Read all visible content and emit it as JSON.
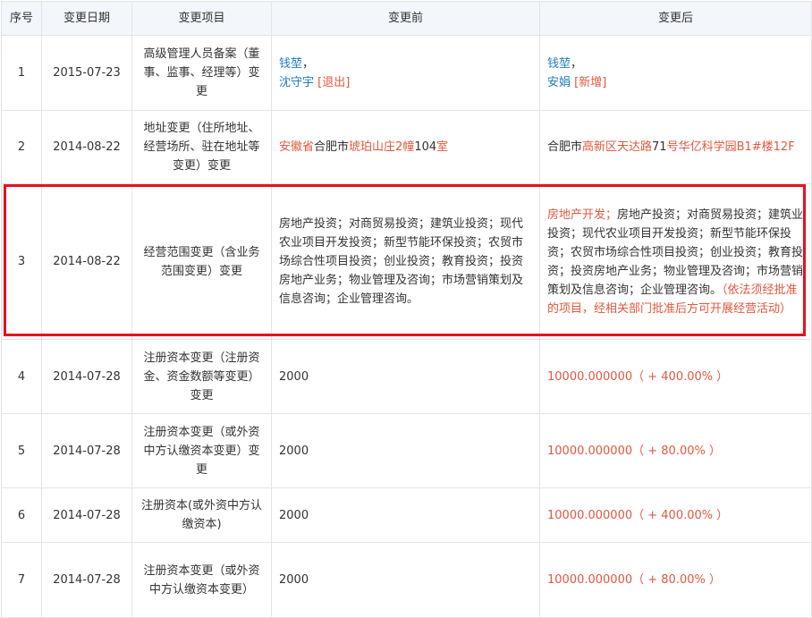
{
  "table": {
    "headers": [
      "序号",
      "变更日期",
      "变更项目",
      "变更前",
      "变更后"
    ],
    "rows": [
      {
        "idx": "1",
        "date": "2015-07-23",
        "item": "高级管理人员备案（董事、监事、经理等）变更",
        "before": {
          "name1": "钱堃",
          "sep1": "，",
          "name2": "沈守宇",
          "tag2": "[退出]"
        },
        "after": {
          "name1": "钱堃",
          "sep1": "，",
          "name2": "安娟",
          "tag2": "[新增]"
        }
      },
      {
        "idx": "2",
        "date": "2014-08-22",
        "item": "地址变更（住所地址、经营场所、驻在地址等变更）变更",
        "before": {
          "seg1": "安徽省",
          "seg2": "合肥市",
          "seg3": "琥珀山庄2幢",
          "seg4": "104",
          "seg5": "室"
        },
        "after": {
          "seg1": "合肥市",
          "seg2": "高新区天达路",
          "seg3": "71",
          "seg4": "号华亿科学园B1#楼12F"
        }
      },
      {
        "idx": "3",
        "date": "2014-08-22",
        "item": "经营范围变更（含业务范围变更）变更",
        "before": "房地产投资；对商贸易投资；建筑业投资；现代农业项目开发投资；新型节能环保投资；农贸市场综合性项目投资；创业投资；教育投资；投资房地产业务；物业管理及咨询；市场营销策划及信息咨询；企业管理咨询。",
        "after": {
          "seg1": "房地产开发；",
          "seg2": "房地产投资；对商贸易投资；建筑业投资；现代农业项目开发投资；新型节能环保投资；农贸市场综合性项目投资；创业投资；教育投资；投资房地产业务；物业管理及咨询；市场营销策划及信息咨询；企业管理咨询。",
          "seg3": "（依法须经批准的项目，经相关部门批准后方可开展经营活动）"
        }
      },
      {
        "idx": "4",
        "date": "2014-07-28",
        "item": "注册资本变更（注册资金、资金数额等变更）变更",
        "before": "2000",
        "after": "10000.000000（ + 400.00% ）"
      },
      {
        "idx": "5",
        "date": "2014-07-28",
        "item": "注册资本变更（或外资中方认缴资本变更）变更",
        "before": "2000",
        "after": "10000.000000（ + 80.00% ）"
      },
      {
        "idx": "6",
        "date": "2014-07-28",
        "item": "注册资本(或外资中方认缴资本)",
        "before": "2000",
        "after": "10000.000000（ + 400.00% ）"
      },
      {
        "idx": "7",
        "date": "2014-07-28",
        "item": "注册资本变更（或外资中方认缴资本变更）",
        "before": "2000",
        "after": "10000.000000（ + 80.00% ）"
      }
    ]
  },
  "colors": {
    "link_blue": "#1f7bc2",
    "change_red": "#e2583e",
    "highlight_border": "#e8101c",
    "header_bg": "#f3f6fb",
    "grid_line": "#e4e4e4"
  }
}
